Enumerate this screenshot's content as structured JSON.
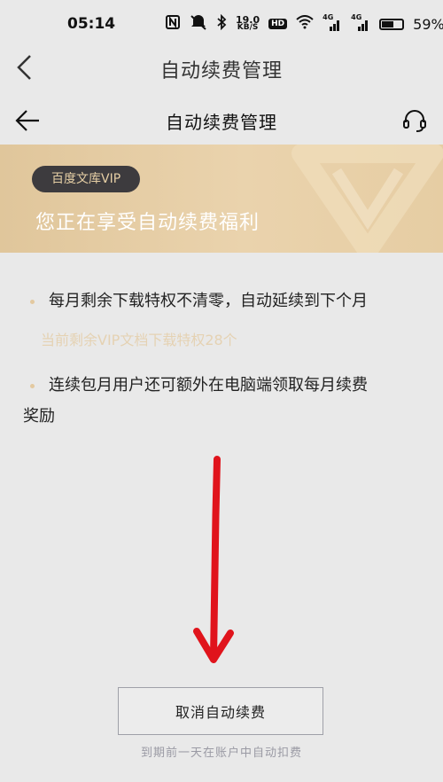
{
  "status_bar": {
    "time": "05:14",
    "speed_value": "19.0",
    "speed_unit": "KB/S",
    "hd_label": "HD",
    "signal1_label": "4G",
    "signal2_label": "4G",
    "battery_percent": "59%",
    "battery_level": 0.59
  },
  "outer_header": {
    "title": "自动续费管理",
    "back_icon": "chevron-left-icon"
  },
  "inner_header": {
    "title": "自动续费管理",
    "back_icon": "arrow-left-icon",
    "service_icon": "headset-icon"
  },
  "banner": {
    "pill_label": "百度文库VIP",
    "title": "您正在享受自动续费福利",
    "colors": {
      "gold": "#e0c69b",
      "pill_bg": "#3d3b3e",
      "pill_text": "#e6cfa5"
    }
  },
  "benefits": {
    "item1": "每月剩余下载特权不清零，自动延续到下个月",
    "item1_sub": "当前剩余VIP文档下载特权28个",
    "item2_line1": "连续包月用户还可额外在电脑端领取每月续费",
    "item2_line2": "奖励"
  },
  "annotation": {
    "arrow_color": "#e0141c"
  },
  "actions": {
    "cancel_label": "取消自动续费",
    "note": "到期前一天在账户中自动扣费"
  }
}
